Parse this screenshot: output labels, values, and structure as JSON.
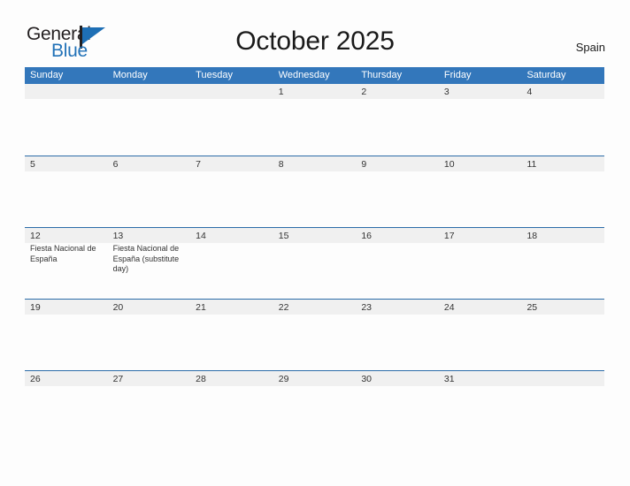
{
  "brand": {
    "name_part1": "General",
    "name_part2": "Blue",
    "logo_icon": "triangle-flag-icon"
  },
  "header": {
    "title": "October 2025",
    "country": "Spain"
  },
  "colors": {
    "header_blue": "#3377bb",
    "divider_blue": "#2b6ca8",
    "brand_blue": "#2272b8",
    "date_band_gray": "#f0f0f0",
    "page_background": "#fdfdfd",
    "text_dark": "#333333"
  },
  "calendar": {
    "month": "October",
    "year": "2025",
    "weekdays": [
      "Sunday",
      "Monday",
      "Tuesday",
      "Wednesday",
      "Thursday",
      "Friday",
      "Saturday"
    ],
    "weeks": [
      [
        {
          "day": ""
        },
        {
          "day": ""
        },
        {
          "day": ""
        },
        {
          "day": "1"
        },
        {
          "day": "2"
        },
        {
          "day": "3"
        },
        {
          "day": "4"
        }
      ],
      [
        {
          "day": "5"
        },
        {
          "day": "6"
        },
        {
          "day": "7"
        },
        {
          "day": "8"
        },
        {
          "day": "9"
        },
        {
          "day": "10"
        },
        {
          "day": "11"
        }
      ],
      [
        {
          "day": "12",
          "event": "Fiesta Nacional de España"
        },
        {
          "day": "13",
          "event": "Fiesta Nacional de España (substitute day)"
        },
        {
          "day": "14"
        },
        {
          "day": "15"
        },
        {
          "day": "16"
        },
        {
          "day": "17"
        },
        {
          "day": "18"
        }
      ],
      [
        {
          "day": "19"
        },
        {
          "day": "20"
        },
        {
          "day": "21"
        },
        {
          "day": "22"
        },
        {
          "day": "23"
        },
        {
          "day": "24"
        },
        {
          "day": "25"
        }
      ],
      [
        {
          "day": "26"
        },
        {
          "day": "27"
        },
        {
          "day": "28"
        },
        {
          "day": "29"
        },
        {
          "day": "30"
        },
        {
          "day": "31"
        },
        {
          "day": ""
        }
      ]
    ]
  }
}
